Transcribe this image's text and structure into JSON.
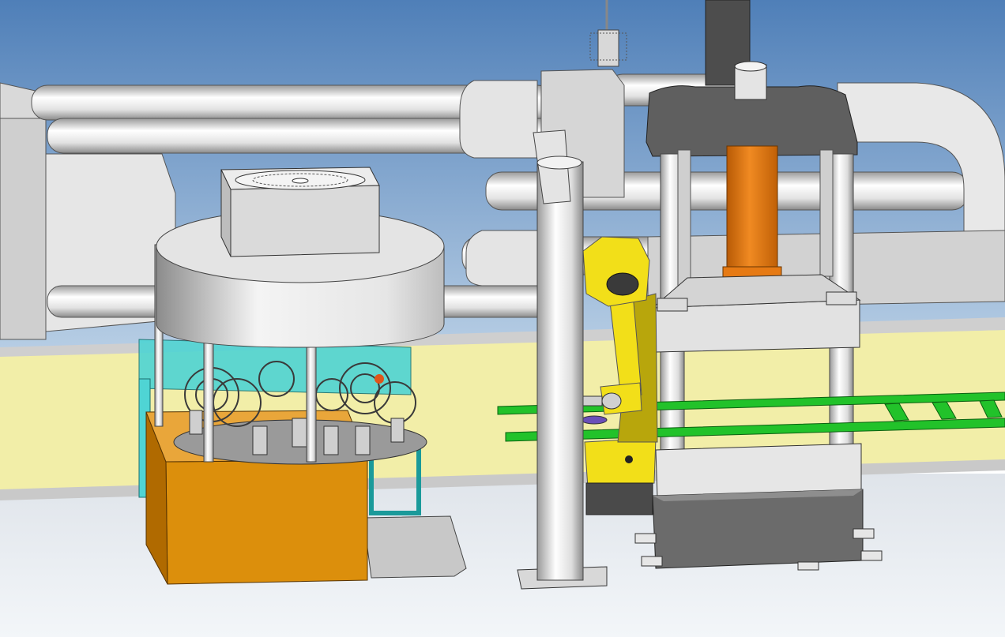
{
  "scene": {
    "palette": {
      "sky_top": "#4f7fb8",
      "sky_bottom": "#b6cde4",
      "floor": "#f3f6f9",
      "wall": "#f2eea8",
      "wall_shadow": "#d9d590",
      "metal_light": "#f0f0f0",
      "metal_mid": "#c8c8c8",
      "metal_dark": "#8e8e8e",
      "dark_gray": "#4d4d4d",
      "orange_box": "#dc8f0c",
      "orange_cylinder": "#e67a14",
      "robot_yellow": "#f2df19",
      "robot_shadow": "#b8a60c",
      "conveyor_green": "#22c22a",
      "cyan_frame": "#4fd4d4",
      "outline": "#333333"
    }
  }
}
